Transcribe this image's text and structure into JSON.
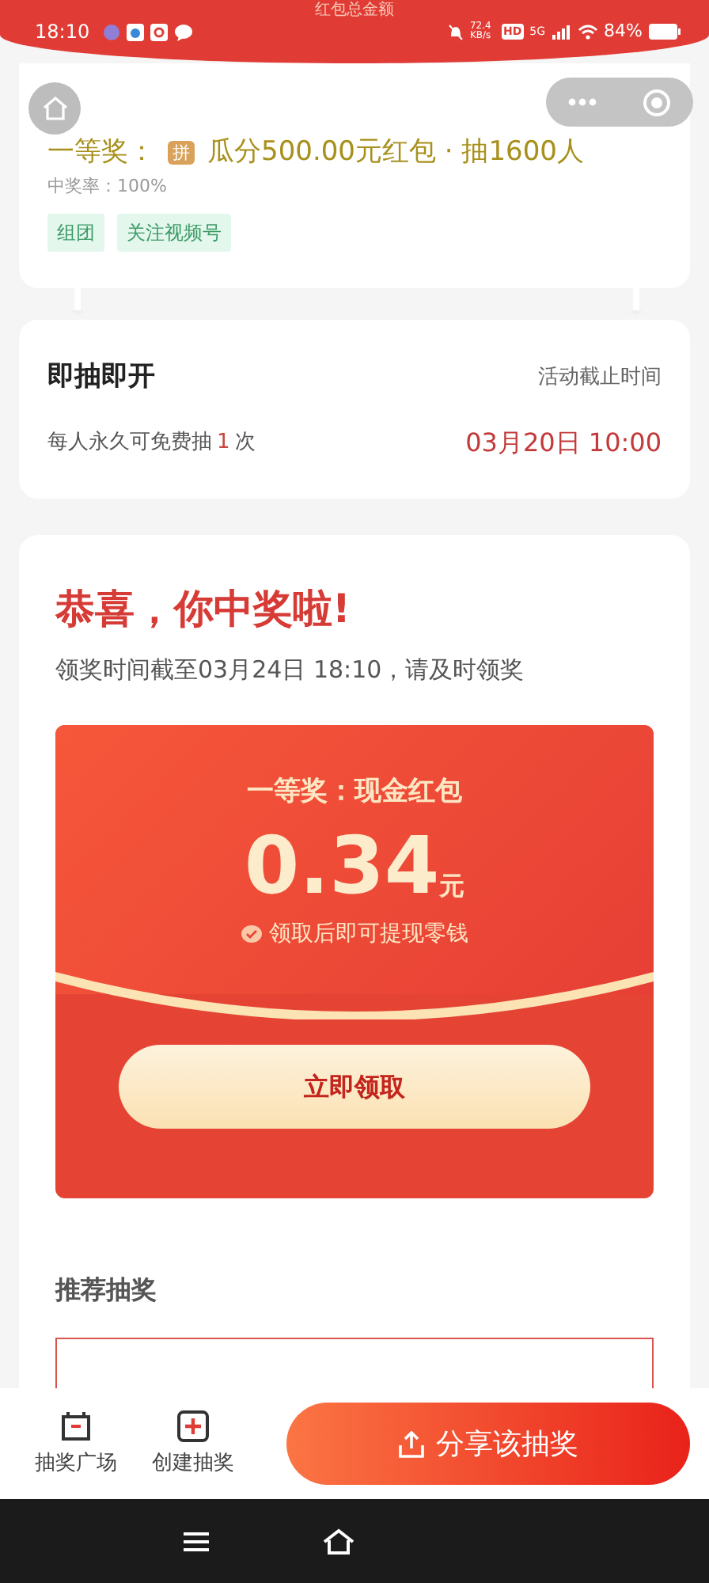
{
  "header": {
    "title": "红包总金额"
  },
  "status_bar": {
    "time": "18:10",
    "network_speed": "72.4 KB/s",
    "hd": "HD",
    "signal": "5G",
    "battery": "84%"
  },
  "prize_card": {
    "prize_label": "一等奖：",
    "badge": "拼",
    "prize_text": "瓜分500.00元红包 · 抽1600人",
    "win_rate": "中奖率：100%",
    "tags": [
      "组团",
      "关注视频号"
    ]
  },
  "draw_card": {
    "title": "即抽即开",
    "deadline_label": "活动截止时间",
    "limit_prefix": "每人永久可免费抽",
    "limit_count": "1",
    "limit_suffix": "次",
    "deadline": "03月20日 10:00"
  },
  "result": {
    "title": "恭喜，你中奖啦!",
    "notice": "领奖时间截至03月24日 18:10，请及时领奖",
    "envelope": {
      "prize": "一等奖：现金红包",
      "amount": "0.34",
      "unit": "元",
      "hint": "领取后即可提现零钱",
      "button": "立即领取"
    }
  },
  "recommend": {
    "title": "推荐抽奖"
  },
  "bottom_bar": {
    "items": [
      {
        "label": "抽奖广场",
        "kind": "square"
      },
      {
        "label": "创建抽奖",
        "kind": "create"
      }
    ],
    "share_button": "分享该抽奖"
  }
}
